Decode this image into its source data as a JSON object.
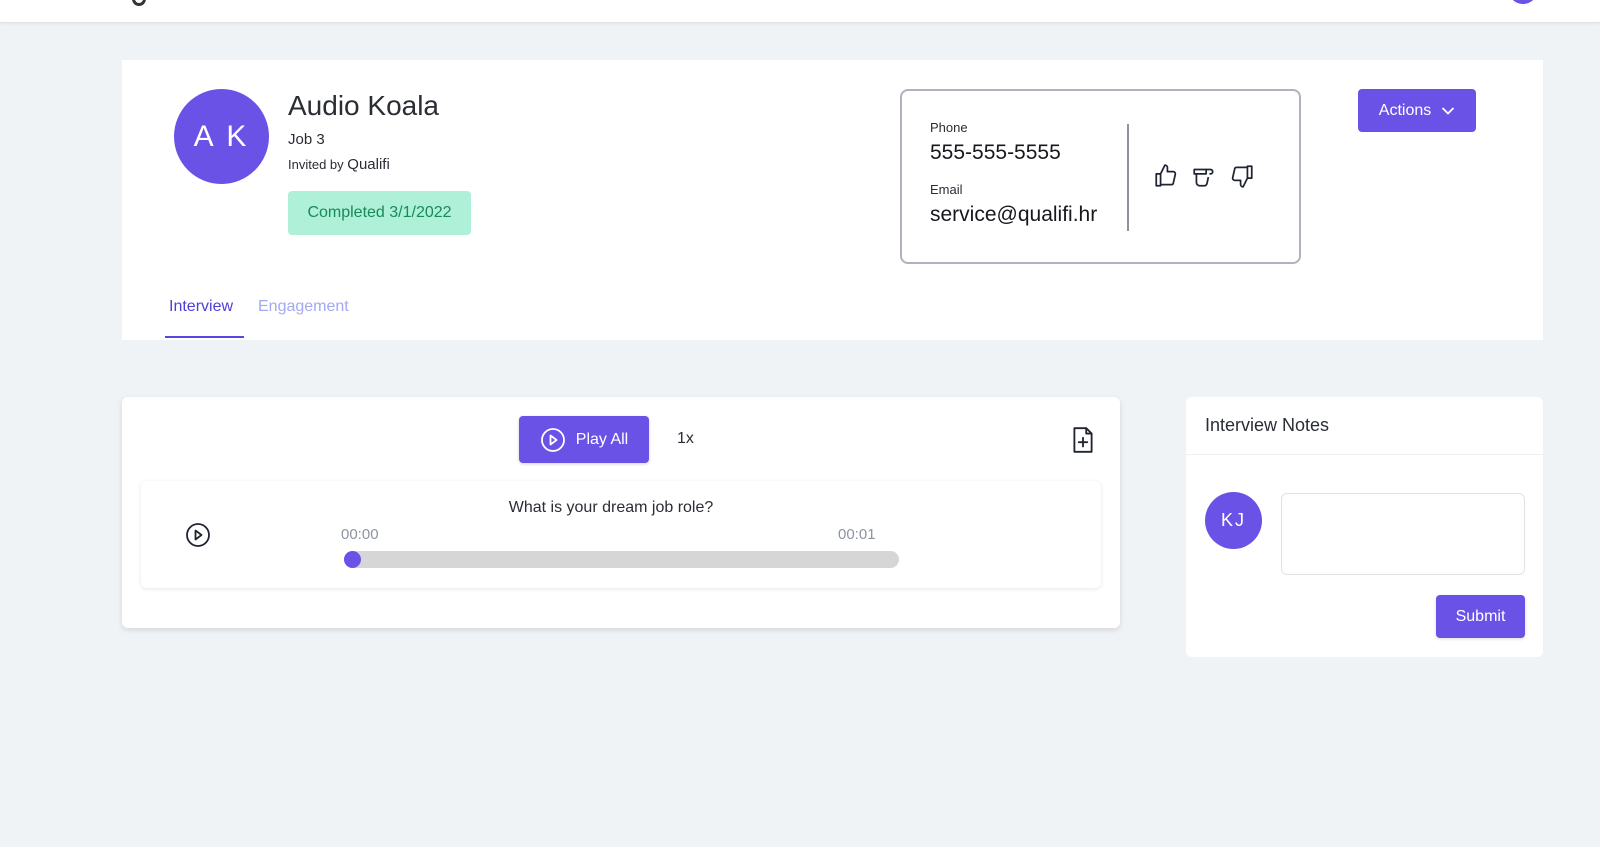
{
  "colors": {
    "accent": "#6b52e6",
    "status_bg": "#aef0d8",
    "status_text": "#178a5a",
    "tab_active": "#4f3ed8",
    "tab_inactive": "#a3a9f0"
  },
  "candidate": {
    "initials": "A K",
    "name": "Audio Koala",
    "job": "Job 3",
    "invited_prefix": "Invited by",
    "invited_by": "Qualifi",
    "status": "Completed 3/1/2022"
  },
  "contact": {
    "phone_label": "Phone",
    "phone": "555-555-5555",
    "email_label": "Email",
    "email": "service@qualifi.hr"
  },
  "rating_icons": [
    "thumbs-up-icon",
    "thumbs-sideways-icon",
    "thumbs-down-icon"
  ],
  "actions": {
    "label": "Actions",
    "icon": "chevron-down-icon"
  },
  "tabs": [
    {
      "label": "Interview",
      "active": true
    },
    {
      "label": "Engagement",
      "active": false
    }
  ],
  "player": {
    "play_all_label": "Play All",
    "speed": "1x",
    "question": {
      "text": "What is your dream job role?",
      "time_current": "00:00",
      "time_total": "00:01",
      "progress": 0.0
    }
  },
  "notes": {
    "title": "Interview Notes",
    "user_initials": "KJ",
    "input_value": "",
    "input_placeholder": "",
    "submit_label": "Submit"
  }
}
